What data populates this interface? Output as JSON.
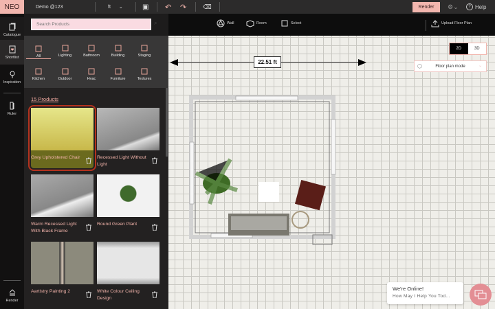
{
  "app": {
    "logo": "NEO",
    "project_name": "Demo @123",
    "unit": "ft",
    "render_label": "Render",
    "help_label": "Help"
  },
  "rail": [
    {
      "label": "Catalogue",
      "icon": "catalogue-icon"
    },
    {
      "label": "Shortlist",
      "icon": "shortlist-icon"
    },
    {
      "label": "Inspiration",
      "icon": "bulb-icon"
    },
    {
      "label": "Ruler",
      "icon": "ruler-icon"
    },
    {
      "label": "Render",
      "icon": "render-icon"
    }
  ],
  "search": {
    "placeholder": "Search Products"
  },
  "categories": [
    {
      "label": "All",
      "active": true
    },
    {
      "label": "Lighting"
    },
    {
      "label": "Bathroom"
    },
    {
      "label": "Building"
    },
    {
      "label": "Staging"
    },
    {
      "label": "Kitchen"
    },
    {
      "label": "Outdoor"
    },
    {
      "label": "Hvac"
    },
    {
      "label": "Furniture"
    },
    {
      "label": "Textures"
    }
  ],
  "products_count": "15 Products",
  "products": [
    {
      "name": "Grey Upholstered Chair",
      "selected": true
    },
    {
      "name": "Recessed Light Without Light"
    },
    {
      "name": "Warm Recessed Light With Black Frame"
    },
    {
      "name": "Round Green Plant"
    },
    {
      "name": "Aartistry Painting 2"
    },
    {
      "name": "White Colour Ceiling Design"
    }
  ],
  "tools": [
    {
      "label": "Wall"
    },
    {
      "label": "Room"
    },
    {
      "label": "Select"
    },
    {
      "label": "Upload Floor Plan"
    }
  ],
  "view": {
    "options": [
      "2D",
      "3D"
    ],
    "selected": "2D",
    "mode": "Floor plan mode"
  },
  "dimension": "22.51 ft",
  "chat": {
    "title": "We're Online!",
    "subtitle": "How May I Help You Tod..."
  },
  "colors": {
    "accent": "#f2b6ae",
    "text_accent": "#f2b3aa",
    "selected_border": "#b4321e"
  }
}
